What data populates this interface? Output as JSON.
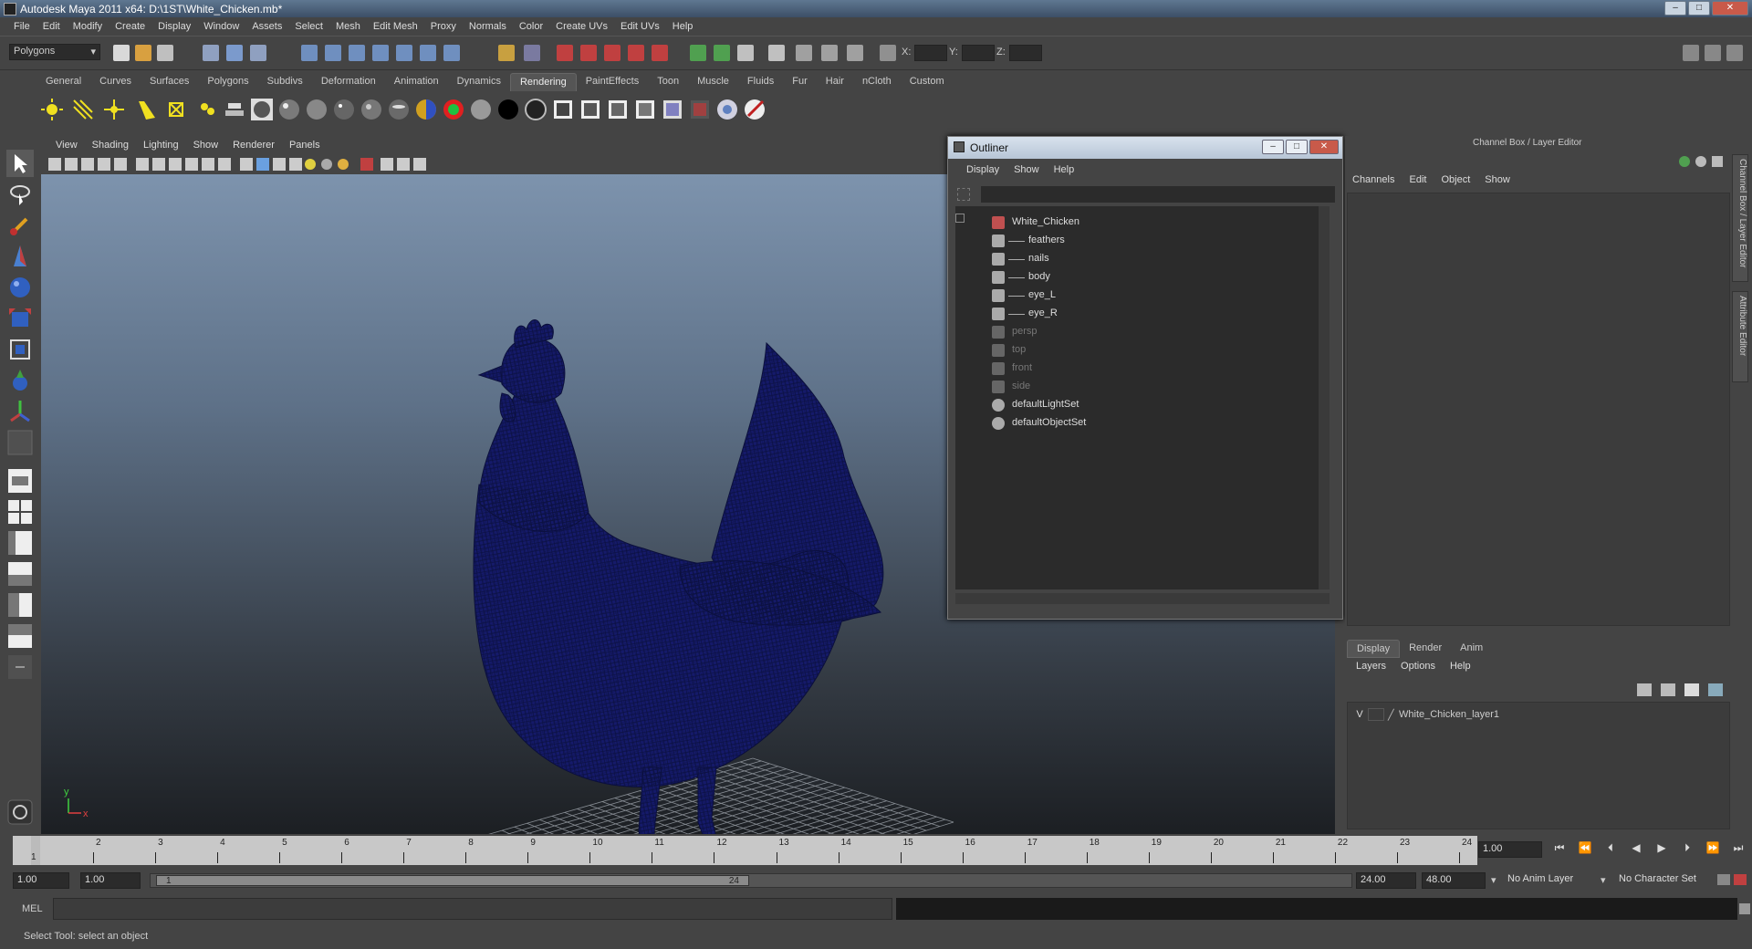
{
  "window": {
    "title": "Autodesk Maya 2011 x64: D:\\1ST\\White_Chicken.mb*",
    "buttons": [
      "–",
      "□",
      "✕"
    ]
  },
  "menubar": [
    "File",
    "Edit",
    "Modify",
    "Create",
    "Display",
    "Window",
    "Assets",
    "Select",
    "Mesh",
    "Edit Mesh",
    "Proxy",
    "Normals",
    "Color",
    "Create UVs",
    "Edit UVs",
    "Help"
  ],
  "statusline": {
    "menu_set": "Polygons",
    "x_label": "X:",
    "y_label": "Y:",
    "z_label": "Z:"
  },
  "shelf": {
    "tabs": [
      "General",
      "Curves",
      "Surfaces",
      "Polygons",
      "Subdivs",
      "Deformation",
      "Animation",
      "Dynamics",
      "Rendering",
      "PaintEffects",
      "Toon",
      "Muscle",
      "Fluids",
      "Fur",
      "Hair",
      "nCloth",
      "Custom"
    ],
    "active_tab": "Rendering"
  },
  "viewport": {
    "menu": [
      "View",
      "Shading",
      "Lighting",
      "Show",
      "Renderer",
      "Panels"
    ],
    "axis_y": "y",
    "axis_x": "x",
    "wire_color": "#151a6b"
  },
  "outliner": {
    "title": "Outliner",
    "menu": [
      "Display",
      "Show",
      "Help"
    ],
    "items": [
      {
        "label": "White_Chicken",
        "level": 0,
        "dim": false
      },
      {
        "label": "feathers",
        "level": 1,
        "dim": false
      },
      {
        "label": "nails",
        "level": 1,
        "dim": false
      },
      {
        "label": "body",
        "level": 1,
        "dim": false
      },
      {
        "label": "eye_L",
        "level": 1,
        "dim": false
      },
      {
        "label": "eye_R",
        "level": 1,
        "dim": false
      },
      {
        "label": "persp",
        "level": 0,
        "dim": true
      },
      {
        "label": "top",
        "level": 0,
        "dim": true
      },
      {
        "label": "front",
        "level": 0,
        "dim": true
      },
      {
        "label": "side",
        "level": 0,
        "dim": true
      },
      {
        "label": "defaultLightSet",
        "level": 0,
        "dim": false
      },
      {
        "label": "defaultObjectSet",
        "level": 0,
        "dim": false
      }
    ]
  },
  "channelbox": {
    "title": "Channel Box / Layer Editor",
    "menu": [
      "Channels",
      "Edit",
      "Object",
      "Show"
    ],
    "side_tabs": [
      "Channel Box / Layer Editor",
      "Attribute Editor"
    ],
    "layer_tabs": [
      "Display",
      "Render",
      "Anim"
    ],
    "layer_menu": [
      "Layers",
      "Options",
      "Help"
    ],
    "layer": {
      "visible": "V",
      "name": "White_Chicken_layer1"
    }
  },
  "timeslider": {
    "ticks": [
      "1",
      "2",
      "3",
      "4",
      "5",
      "6",
      "7",
      "8",
      "9",
      "10",
      "11",
      "12",
      "13",
      "14",
      "15",
      "16",
      "17",
      "18",
      "19",
      "20",
      "21",
      "22",
      "23",
      "24"
    ],
    "current_frame_label": "1",
    "current_frame": "1.00"
  },
  "rangeslider": {
    "start": "1.00",
    "anim_start": "1.00",
    "range_start": "1",
    "range_end": "24",
    "anim_end": "24.00",
    "end": "48.00",
    "anim_layer": "No Anim Layer",
    "character_set": "No Character Set"
  },
  "cmdline": {
    "label": "MEL"
  },
  "helpline": {
    "text": "Select Tool: select an object"
  }
}
